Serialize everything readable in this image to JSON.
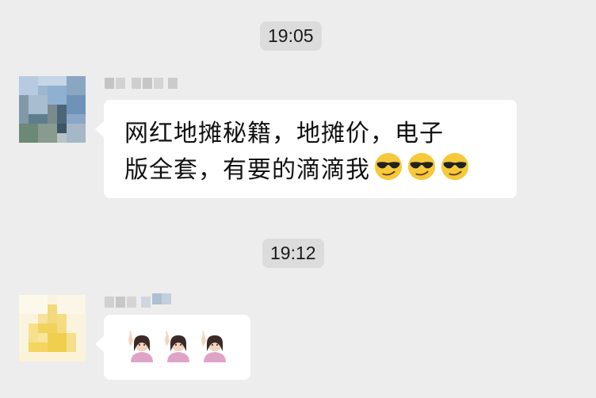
{
  "chat": {
    "timestamps": [
      "19:05",
      "19:12"
    ],
    "messages": [
      {
        "text": "网红地摊秘籍，地摊价，电子\n版全套，有要的滴滴我",
        "emojis": [
          "smirk-sunglasses-emoji",
          "smirk-sunglasses-emoji",
          "smirk-sunglasses-emoji"
        ]
      },
      {
        "text": "",
        "emojis": [
          "woman-raising-hand-emoji",
          "woman-raising-hand-emoji",
          "woman-raising-hand-emoji"
        ]
      }
    ]
  },
  "colors": {
    "background": "#ededed",
    "bubble": "#ffffff",
    "timestamp_bg": "#dcdcdc"
  }
}
